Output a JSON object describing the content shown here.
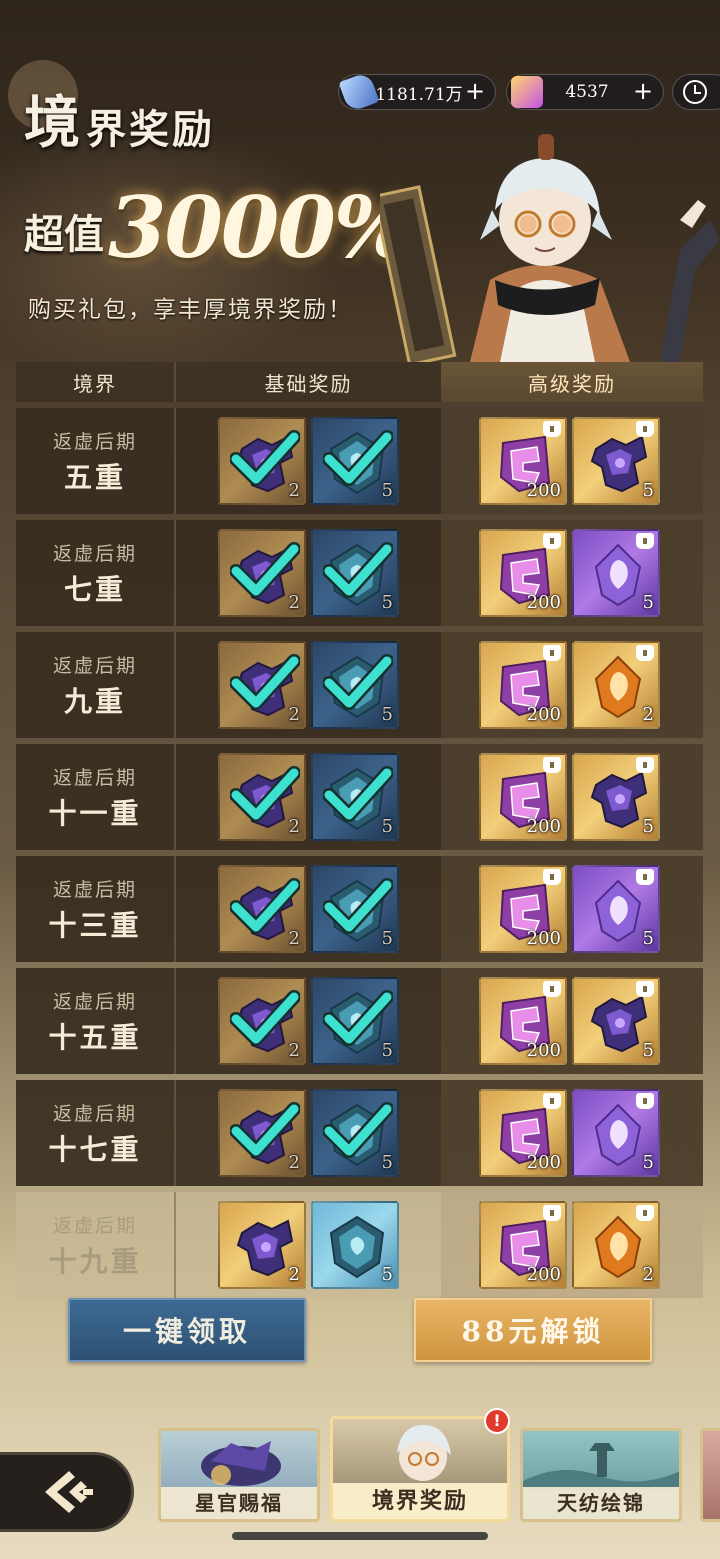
{
  "header": {
    "title_big": "境",
    "title_rest": "界奖励",
    "promo_label": "超值",
    "promo_value": "3000%",
    "subtitle": "购买礼包，享丰厚境界奖励！"
  },
  "currency": {
    "jade": "1181.71万",
    "ingot": "4537",
    "plus": "+"
  },
  "table": {
    "headers": {
      "realm": "境界",
      "basic": "基础奖励",
      "advanced": "高级奖励"
    },
    "rows": [
      {
        "stage": "返虚后期",
        "level": "五重",
        "basic": [
          {
            "icon": "armor",
            "qty": "2",
            "claimed": true
          },
          {
            "icon": "jade",
            "qty": "5",
            "claimed": true
          }
        ],
        "advanced": [
          {
            "icon": "rune",
            "qty": "200"
          },
          {
            "icon": "armor",
            "qty": "5"
          }
        ]
      },
      {
        "stage": "返虚后期",
        "level": "七重",
        "basic": [
          {
            "icon": "armor",
            "qty": "2",
            "claimed": true
          },
          {
            "icon": "jade",
            "qty": "5",
            "claimed": true
          }
        ],
        "advanced": [
          {
            "icon": "rune",
            "qty": "200"
          },
          {
            "icon": "purple-gem",
            "qty": "5"
          }
        ]
      },
      {
        "stage": "返虚后期",
        "level": "九重",
        "basic": [
          {
            "icon": "armor",
            "qty": "2",
            "claimed": true
          },
          {
            "icon": "jade",
            "qty": "5",
            "claimed": true
          }
        ],
        "advanced": [
          {
            "icon": "rune",
            "qty": "200"
          },
          {
            "icon": "orange-gem",
            "qty": "2"
          }
        ]
      },
      {
        "stage": "返虚后期",
        "level": "十一重",
        "basic": [
          {
            "icon": "armor",
            "qty": "2",
            "claimed": true
          },
          {
            "icon": "jade",
            "qty": "5",
            "claimed": true
          }
        ],
        "advanced": [
          {
            "icon": "rune",
            "qty": "200"
          },
          {
            "icon": "armor",
            "qty": "5"
          }
        ]
      },
      {
        "stage": "返虚后期",
        "level": "十三重",
        "basic": [
          {
            "icon": "armor",
            "qty": "2",
            "claimed": true
          },
          {
            "icon": "jade",
            "qty": "5",
            "claimed": true
          }
        ],
        "advanced": [
          {
            "icon": "rune",
            "qty": "200"
          },
          {
            "icon": "purple-gem",
            "qty": "5"
          }
        ]
      },
      {
        "stage": "返虚后期",
        "level": "十五重",
        "basic": [
          {
            "icon": "armor",
            "qty": "2",
            "claimed": true
          },
          {
            "icon": "jade",
            "qty": "5",
            "claimed": true
          }
        ],
        "advanced": [
          {
            "icon": "rune",
            "qty": "200"
          },
          {
            "icon": "armor",
            "qty": "5"
          }
        ]
      },
      {
        "stage": "返虚后期",
        "level": "十七重",
        "basic": [
          {
            "icon": "armor",
            "qty": "2",
            "claimed": true
          },
          {
            "icon": "jade",
            "qty": "5",
            "claimed": true
          }
        ],
        "advanced": [
          {
            "icon": "rune",
            "qty": "200"
          },
          {
            "icon": "purple-gem",
            "qty": "5"
          }
        ]
      },
      {
        "stage": "返虚后期",
        "level": "十九重",
        "locked": true,
        "basic": [
          {
            "icon": "armor",
            "qty": "2",
            "claimed": false
          },
          {
            "icon": "jade",
            "qty": "5",
            "claimed": false
          }
        ],
        "advanced": [
          {
            "icon": "rune",
            "qty": "200"
          },
          {
            "icon": "orange-gem",
            "qty": "2"
          }
        ]
      }
    ]
  },
  "buttons": {
    "claim_all": "一键领取",
    "unlock": "88元解锁"
  },
  "nav": {
    "tabs": [
      "星官赐福",
      "境界奖励",
      "天纺绘锦"
    ],
    "badge": "!"
  },
  "colors": {
    "accent_gold": "#e8b565",
    "claim_blue": "#3e6a93",
    "check_teal": "#3ee0d0"
  }
}
